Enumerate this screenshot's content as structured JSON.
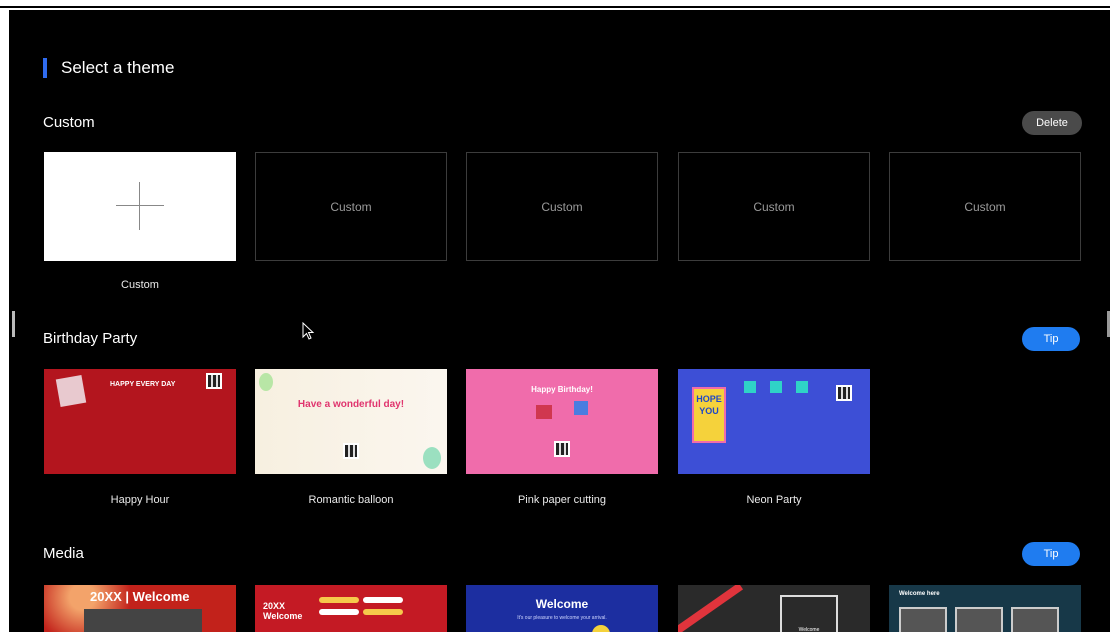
{
  "header": {
    "title": "Select a theme"
  },
  "custom": {
    "title": "Custom",
    "delete_label": "Delete",
    "add_caption": "Custom",
    "slots": [
      "Custom",
      "Custom",
      "Custom",
      "Custom"
    ]
  },
  "birthday": {
    "title": "Birthday Party",
    "tip_label": "Tip",
    "themes": [
      {
        "caption": "Happy Hour",
        "text": "HAPPY EVERY DAY"
      },
      {
        "caption": "Romantic balloon",
        "text": "Have a wonderful day!"
      },
      {
        "caption": "Pink paper cutting",
        "text": "Happy Birthday!"
      },
      {
        "caption": "Neon Party",
        "text": "HOPE YOU"
      }
    ]
  },
  "media": {
    "title": "Media",
    "tip_label": "Tip",
    "themes": [
      {
        "text": "20XX | Welcome"
      },
      {
        "text": "20XX Welcome"
      },
      {
        "text": "Welcome",
        "subtext": "It's our pleasure to welcome your arrival."
      },
      {
        "text": "Welcome"
      },
      {
        "text": "Welcome here"
      }
    ]
  },
  "colors": {
    "accent": "#2f6bf0",
    "tip": "#1f7cf0",
    "delete": "#4a4a4a"
  }
}
